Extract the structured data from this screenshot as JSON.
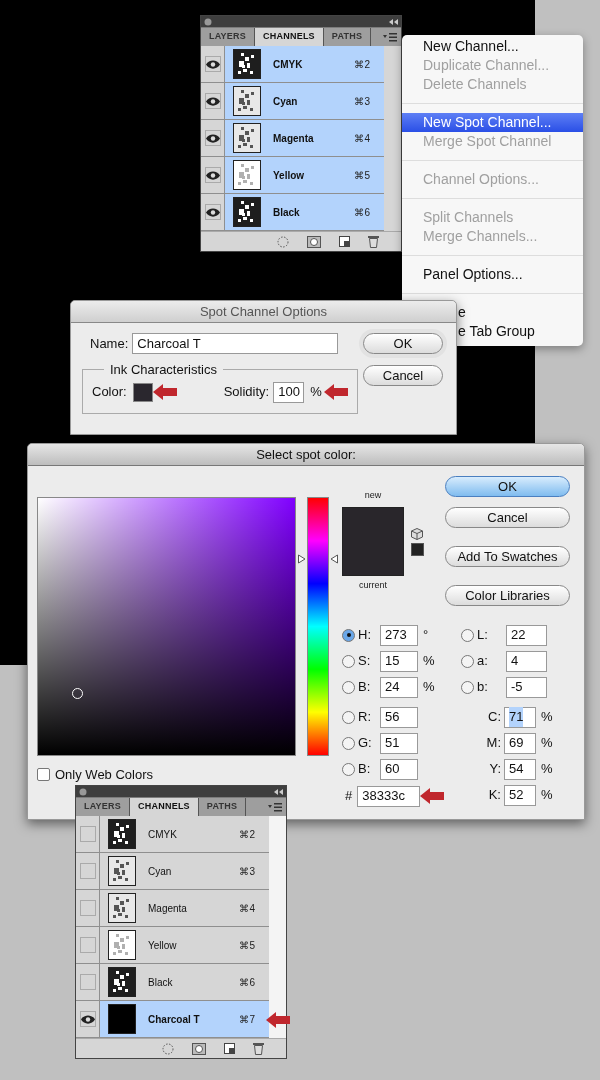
{
  "top_channels_panel": {
    "tabs": [
      {
        "label": "LAYERS",
        "selected": false
      },
      {
        "label": "CHANNELS",
        "selected": true
      },
      {
        "label": "PATHS",
        "selected": false
      }
    ],
    "rows": [
      {
        "name": "CMYK",
        "shortcut": "⌘2",
        "kind": "dark",
        "visible": true,
        "selected": true
      },
      {
        "name": "Cyan",
        "shortcut": "⌘3",
        "kind": "light",
        "visible": true,
        "selected": true
      },
      {
        "name": "Magenta",
        "shortcut": "⌘4",
        "kind": "light",
        "visible": true,
        "selected": true
      },
      {
        "name": "Yellow",
        "shortcut": "⌘5",
        "kind": "pale",
        "visible": true,
        "selected": true
      },
      {
        "name": "Black",
        "shortcut": "⌘6",
        "kind": "dark",
        "visible": true,
        "selected": true
      }
    ]
  },
  "panel_menu": {
    "items": [
      {
        "kind": "item",
        "label": "New Channel...",
        "disabled": false,
        "selected": false,
        "covered": false
      },
      {
        "kind": "item",
        "label": "Duplicate Channel...",
        "disabled": true,
        "selected": false,
        "covered": false
      },
      {
        "kind": "item",
        "label": "Delete Channels",
        "disabled": true,
        "selected": false,
        "covered": false
      },
      {
        "kind": "separator"
      },
      {
        "kind": "item",
        "label": "New Spot Channel...",
        "disabled": false,
        "selected": true,
        "covered": false
      },
      {
        "kind": "item",
        "label": "Merge Spot Channel",
        "disabled": true,
        "selected": false,
        "covered": false
      },
      {
        "kind": "separator"
      },
      {
        "kind": "item",
        "label": "Channel Options...",
        "disabled": true,
        "selected": false,
        "covered": false
      },
      {
        "kind": "separator"
      },
      {
        "kind": "item",
        "label": "Split Channels",
        "disabled": true,
        "selected": false,
        "covered": false
      },
      {
        "kind": "item",
        "label": "Merge Channels...",
        "disabled": true,
        "selected": false,
        "covered": false
      },
      {
        "kind": "separator"
      },
      {
        "kind": "item",
        "label": "Panel Options...",
        "disabled": false,
        "selected": false,
        "covered": false
      },
      {
        "kind": "separator"
      },
      {
        "kind": "item",
        "label": "e",
        "disabled": false,
        "selected": false,
        "covered": true
      },
      {
        "kind": "item",
        "label": "e Tab Group",
        "disabled": false,
        "selected": false,
        "covered": true
      }
    ]
  },
  "spot_channel_options": {
    "title": "Spot Channel Options",
    "name_label": "Name:",
    "name_value": "Charcoal T",
    "ink_legend": "Ink Characteristics",
    "color_label": "Color:",
    "solidity_label": "Solidity:",
    "solidity_value": "100",
    "solidity_unit": "%",
    "buttons": [
      {
        "label": "OK",
        "kind": "default"
      },
      {
        "label": "Cancel",
        "kind": "plain"
      }
    ]
  },
  "color_picker": {
    "title": "Select spot color:",
    "hue_slider": {
      "level": 0.76
    },
    "new_label": "new",
    "current_label": "current",
    "buttons": [
      {
        "label": "OK",
        "kind": "primary"
      },
      {
        "label": "Cancel",
        "kind": "plain"
      },
      {
        "label": "Add To Swatches",
        "kind": "plain"
      },
      {
        "label": "Color Libraries",
        "kind": "plain"
      }
    ],
    "hsb_fields": [
      {
        "label": "H:",
        "value": "273",
        "unit": "°",
        "selected": true
      },
      {
        "label": "S:",
        "value": "15",
        "unit": "%",
        "selected": false
      },
      {
        "label": "B:",
        "value": "24",
        "unit": "%",
        "selected": false
      }
    ],
    "rgb_fields": [
      {
        "label": "R:",
        "value": "56",
        "selected": false
      },
      {
        "label": "G:",
        "value": "51",
        "selected": false
      },
      {
        "label": "B:",
        "value": "60",
        "selected": false
      }
    ],
    "lab_fields": [
      {
        "label": "L:",
        "value": "22",
        "selected": false
      },
      {
        "label": "a:",
        "value": "4",
        "selected": false
      },
      {
        "label": "b:",
        "value": "-5",
        "selected": false
      }
    ],
    "cmyk_fields": [
      {
        "label": "C:",
        "value": "71",
        "unit": "%",
        "highlighted": true
      },
      {
        "label": "M:",
        "value": "69",
        "unit": "%",
        "highlighted": false
      },
      {
        "label": "Y:",
        "value": "54",
        "unit": "%",
        "highlighted": false
      },
      {
        "label": "K:",
        "value": "52",
        "unit": "%",
        "highlighted": false
      }
    ],
    "hex_label": "#",
    "hex_value": "38333c",
    "web_colors": {
      "label": "Only Web Colors",
      "checked": false
    }
  },
  "bottom_channels_panel": {
    "tabs": [
      {
        "label": "LAYERS",
        "selected": false
      },
      {
        "label": "CHANNELS",
        "selected": true
      },
      {
        "label": "PATHS",
        "selected": false
      }
    ],
    "rows": [
      {
        "name": "CMYK",
        "shortcut": "⌘2",
        "kind": "dark",
        "visible": false,
        "selected": false
      },
      {
        "name": "Cyan",
        "shortcut": "⌘3",
        "kind": "light",
        "visible": false,
        "selected": false
      },
      {
        "name": "Magenta",
        "shortcut": "⌘4",
        "kind": "light",
        "visible": false,
        "selected": false
      },
      {
        "name": "Yellow",
        "shortcut": "⌘5",
        "kind": "pale",
        "visible": false,
        "selected": false
      },
      {
        "name": "Black",
        "shortcut": "⌘6",
        "kind": "dark",
        "visible": false,
        "selected": false
      },
      {
        "name": "Charcoal T",
        "shortcut": "⌘7",
        "kind": "spot",
        "visible": true,
        "selected": true
      }
    ]
  }
}
